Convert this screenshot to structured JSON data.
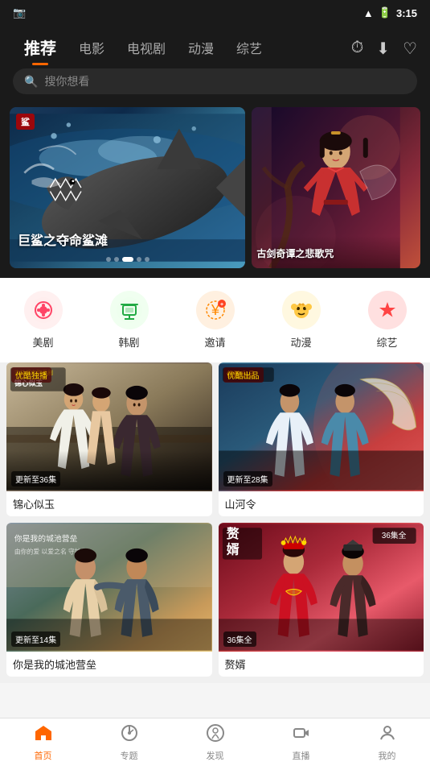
{
  "statusBar": {
    "time": "3:15",
    "icons": [
      "camera",
      "wifi",
      "battery"
    ]
  },
  "header": {
    "tabs": [
      {
        "id": "recommend",
        "label": "推荐",
        "active": true
      },
      {
        "id": "movie",
        "label": "电影",
        "active": false
      },
      {
        "id": "tvshow",
        "label": "电视剧",
        "active": false
      },
      {
        "id": "anime",
        "label": "动漫",
        "active": false
      },
      {
        "id": "variety",
        "label": "综艺",
        "active": false
      }
    ],
    "searchPlaceholder": "搜你想看",
    "actions": [
      "history-icon",
      "download-icon",
      "like-icon"
    ]
  },
  "banners": {
    "main": {
      "label": "鲨",
      "title": "巨鲨之夺命鲨滩",
      "dots": [
        false,
        false,
        true,
        false,
        false
      ]
    },
    "side": {
      "title": "古剑奇谭之悲歌咒"
    }
  },
  "categories": [
    {
      "id": "meiju",
      "label": "美剧",
      "emoji": "🎬",
      "colorClass": "icon-meiju"
    },
    {
      "id": "hanju",
      "label": "韩剧",
      "emoji": "📺",
      "colorClass": "icon-hanju"
    },
    {
      "id": "invite",
      "label": "邀请",
      "emoji": "🎁",
      "colorClass": "icon-invite"
    },
    {
      "id": "dongman",
      "label": "动漫",
      "emoji": "🐻",
      "colorClass": "icon-dongman"
    },
    {
      "id": "zongyi",
      "label": "综艺",
      "emoji": "⭐",
      "colorClass": "icon-zongyi"
    }
  ],
  "contentCards": [
    {
      "id": "jxsy",
      "badge": "优酷独播",
      "episode": "更新至36集",
      "title": "锦心似玉",
      "bgClass": "card-jxsy"
    },
    {
      "id": "shl",
      "badge": "优酷出品",
      "episode": "更新至28集",
      "title": "山河令",
      "bgClass": "card-shl"
    },
    {
      "id": "nwcq",
      "badge": "",
      "episode": "更新至14集",
      "title": "你是我的城池营垒",
      "bgClass": "card-nwcq"
    },
    {
      "id": "zp",
      "badge": "36集全",
      "episode": "36集全",
      "title": "赘婿",
      "bgClass": "card-zp"
    }
  ],
  "bottomNav": [
    {
      "id": "home",
      "label": "首页",
      "emoji": "🏠",
      "active": true
    },
    {
      "id": "special",
      "label": "专题",
      "emoji": "🧭",
      "active": false
    },
    {
      "id": "discover",
      "label": "发现",
      "emoji": "😊",
      "active": false
    },
    {
      "id": "live",
      "label": "直播",
      "emoji": "📹",
      "active": false
    },
    {
      "id": "profile",
      "label": "我的",
      "emoji": "👤",
      "active": false
    }
  ],
  "appIcon": "📷"
}
